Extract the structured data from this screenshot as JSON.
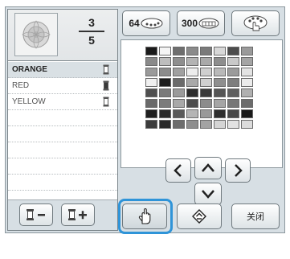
{
  "preview": {
    "current": "3",
    "total": "5"
  },
  "colors": [
    {
      "name": "ORANGE",
      "selected": true
    },
    {
      "name": "RED",
      "selected": false
    },
    {
      "name": "YELLOW",
      "selected": false
    },
    {
      "name": "",
      "selected": false
    },
    {
      "name": "",
      "selected": false
    },
    {
      "name": "",
      "selected": false
    },
    {
      "name": "",
      "selected": false
    },
    {
      "name": "",
      "selected": false
    }
  ],
  "toolbar": {
    "btn64_label": "64",
    "btn300_label": "300",
    "close_label": "关闭"
  },
  "palette_rows": [
    [
      "#1a1a1a",
      "#f4f4f4",
      "#6e6e6e",
      "#8a8a8a",
      "#7a7a7a",
      "#d8d8d8",
      "#4c4c4c",
      "#9a9a9a"
    ],
    [
      "#8a8a8a",
      "#bdbdbd",
      "#8f8f8f",
      "#b3b3b3",
      "#a9a9a9",
      "#8e8e8e",
      "#c9c9c9",
      "#a4a4a4"
    ],
    [
      "#9a9a9a",
      "#8c8c8c",
      "#a0a0a0",
      "#ededed",
      "#cfcfcf",
      "#b9b9b9",
      "#9b9b9b",
      "#e3e3e3"
    ],
    [
      "#f0f0f0",
      "#1c1c1c",
      "#6b6b6b",
      "#a9a9a9",
      "#d0d0d0",
      "#8f8f8f",
      "#7e7e7e",
      "#ececec"
    ],
    [
      "#4f4f4f",
      "#7a7a7a",
      "#9b9b9b",
      "#2c2c2c",
      "#3a3a3a",
      "#555555",
      "#5f5f5f",
      "#b0b0b0"
    ],
    [
      "#6a6a6a",
      "#7c7c7c",
      "#a8a8a8",
      "#4d4d4d",
      "#8c8c8c",
      "#a5a5a5",
      "#777777",
      "#6c6c6c"
    ],
    [
      "#1f1f1f",
      "#2b2b2b",
      "#5a5a5a",
      "#b4b4b4",
      "#999999",
      "#2e2e2e",
      "#474747",
      "#1a1a1a"
    ],
    [
      "#3c3c3c",
      "#2a2a2a",
      "#6d6d6d",
      "#8e8e8e",
      "#a3a3a3",
      "#d5d5d5",
      "#e2e2e2",
      "#dcdcdc"
    ]
  ]
}
